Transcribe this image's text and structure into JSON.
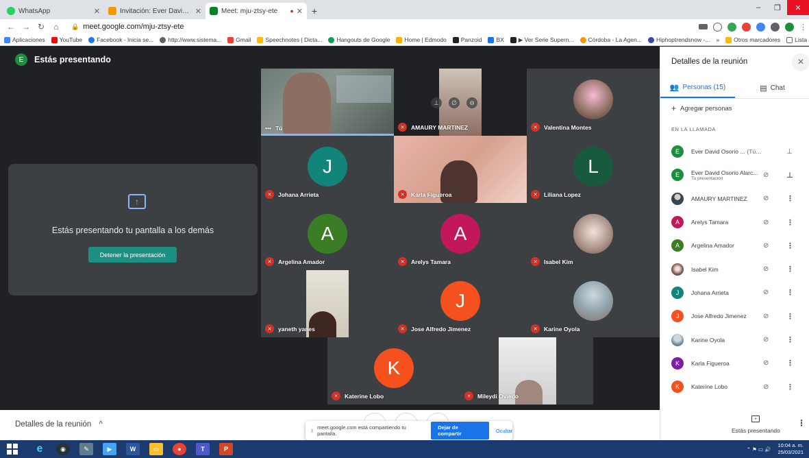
{
  "browser": {
    "tabs": [
      {
        "title": "WhatsApp",
        "favicon_color": "#25d366",
        "active": false
      },
      {
        "title": "Invitación: Ever David Osorio Ala",
        "favicon_color": "#f29900",
        "active": false
      },
      {
        "title": "Meet: mju-ztsy-ete",
        "favicon_color": "#00832d",
        "active": true
      }
    ],
    "url": "meet.google.com/mju-ztsy-ete",
    "bookmarks": [
      "Aplicaciones",
      "YouTube",
      "Facebook - Inicia se...",
      "http://www.sistema...",
      "Gmail",
      "Speechnotes | Dicta...",
      "Hangouts de Google",
      "Home | Edmodo",
      "Panzoid",
      "BX",
      "▶ Ver Serie Supern...",
      "Córdoba - La Agen...",
      "Hiphoptrendsnow -..."
    ],
    "bookmarks_overflow": "»",
    "other_bookmarks": "Otros marcadores",
    "reading_list": "Lista de lectura"
  },
  "meet": {
    "presenting_label": "Estás presentando",
    "presenter_initial": "E",
    "share_panel": {
      "message": "Estás presentando tu pantalla a los demás",
      "stop_button": "Detener la presentación"
    },
    "tiles": [
      {
        "name": "Tú",
        "type": "video",
        "muted": false
      },
      {
        "name": "AMAURY MARTINEZ",
        "type": "video",
        "muted": true
      },
      {
        "name": "Valentina Montes",
        "type": "photo",
        "muted": true
      },
      {
        "name": "Johana Arrieta",
        "type": "letter",
        "letter": "J",
        "color": "#12857a",
        "muted": true
      },
      {
        "name": "Karla Figueroa",
        "type": "video",
        "muted": true
      },
      {
        "name": "Liliana Lopez",
        "type": "letter",
        "letter": "L",
        "color": "#185a3e",
        "muted": true
      },
      {
        "name": "Argelina Amador",
        "type": "letter",
        "letter": "A",
        "color": "#3a7d24",
        "muted": true
      },
      {
        "name": "Arelys Tamara",
        "type": "letter",
        "letter": "A",
        "color": "#c2185b",
        "muted": true
      },
      {
        "name": "Isabel Kim",
        "type": "photo",
        "muted": true
      },
      {
        "name": "yaneth yanes",
        "type": "video",
        "muted": true
      },
      {
        "name": "Jose Alfredo Jimenez",
        "type": "letter",
        "letter": "J",
        "color": "#f4511e",
        "muted": true
      },
      {
        "name": "Karine Oyola",
        "type": "photo",
        "muted": true
      },
      {
        "name": "Katerine Lobo",
        "type": "letter",
        "letter": "K",
        "color": "#f4511e",
        "muted": true
      },
      {
        "name": "Mileydi Oviedo",
        "type": "video",
        "muted": true
      }
    ],
    "bottom": {
      "details_label": "Detalles de la reunión",
      "share_notice": "meet.google.com está compartiendo tu pantalla.",
      "stop_sharing": "Dejar de compartir",
      "hide": "Ocultar"
    }
  },
  "side_panel": {
    "title": "Detalles de la reunión",
    "tab_people": "Personas (15)",
    "tab_chat": "Chat",
    "add_people": "Agregar personas",
    "section_label": "EN LA LLAMADA",
    "participants": [
      {
        "name": "Ever David Osorio ...",
        "suffix": "(Tú)",
        "sub": "",
        "initial": "E",
        "color": "#1e8e3e"
      },
      {
        "name": "Ever David Osorio Alarc...",
        "suffix": "",
        "sub": "Tu presentación",
        "initial": "E",
        "color": "#1e8e3e"
      },
      {
        "name": "AMAURY MARTINEZ",
        "suffix": "",
        "sub": "",
        "initial": "",
        "color": "#5f6368"
      },
      {
        "name": "Arelys Tamara",
        "suffix": "",
        "sub": "",
        "initial": "A",
        "color": "#c2185b"
      },
      {
        "name": "Argelina Amador",
        "suffix": "",
        "sub": "",
        "initial": "A",
        "color": "#3a7d24"
      },
      {
        "name": "Isabel Kim",
        "suffix": "",
        "sub": "",
        "initial": "",
        "color": "#a1887f"
      },
      {
        "name": "Johana Arrieta",
        "suffix": "",
        "sub": "",
        "initial": "J",
        "color": "#12857a"
      },
      {
        "name": "Jose Alfredo Jimenez",
        "suffix": "",
        "sub": "",
        "initial": "J",
        "color": "#f4511e"
      },
      {
        "name": "Karine Oyola",
        "suffix": "",
        "sub": "",
        "initial": "",
        "color": "#90a4ae"
      },
      {
        "name": "Karla Figueroa",
        "suffix": "",
        "sub": "",
        "initial": "K",
        "color": "#7b1fa2"
      },
      {
        "name": "Katerine Lobo",
        "suffix": "",
        "sub": "",
        "initial": "K",
        "color": "#f4511e"
      }
    ],
    "presenting_label": "Estás presentando"
  },
  "taskbar": {
    "time": "10:04 a. m.",
    "date": "25/03/2021"
  }
}
